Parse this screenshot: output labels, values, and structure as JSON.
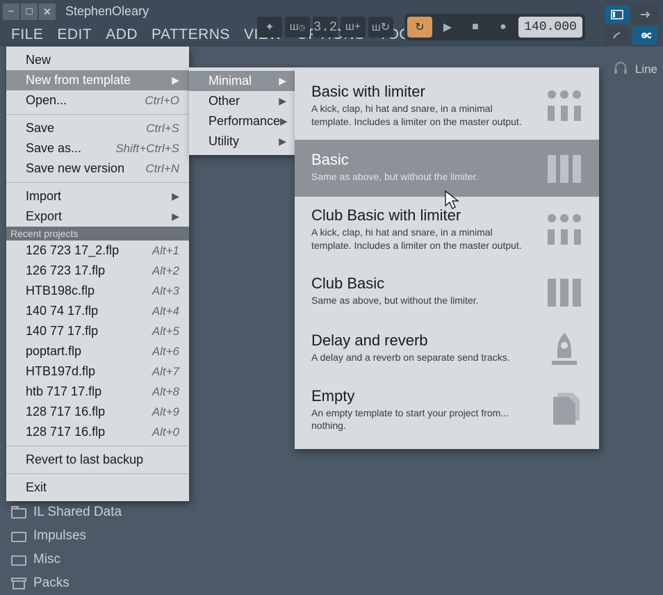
{
  "title": "StephenOleary",
  "menubar": [
    "FILE",
    "EDIT",
    "ADD",
    "PATTERNS",
    "VIEW",
    "OPTIONS",
    "TOOLS",
    "?"
  ],
  "file_menu": {
    "items1": [
      {
        "label": "New",
        "sc": "",
        "arrow": false,
        "hi": false
      },
      {
        "label": "New from template",
        "sc": "",
        "arrow": true,
        "hi": true
      },
      {
        "label": "Open...",
        "sc": "Ctrl+O",
        "arrow": false,
        "hi": false
      }
    ],
    "items2": [
      {
        "label": "Save",
        "sc": "Ctrl+S"
      },
      {
        "label": "Save as...",
        "sc": "Shift+Ctrl+S"
      },
      {
        "label": "Save new version",
        "sc": "Ctrl+N"
      }
    ],
    "items3": [
      {
        "label": "Import",
        "arrow": true
      },
      {
        "label": "Export",
        "arrow": true
      }
    ],
    "recent_header": "Recent projects",
    "recent": [
      {
        "label": "126 723 17_2.flp",
        "sc": "Alt+1"
      },
      {
        "label": "126 723 17.flp",
        "sc": "Alt+2"
      },
      {
        "label": "HTB198c.flp",
        "sc": "Alt+3"
      },
      {
        "label": "140 74 17.flp",
        "sc": "Alt+4"
      },
      {
        "label": "140 77 17.flp",
        "sc": "Alt+5"
      },
      {
        "label": "poptart.flp",
        "sc": "Alt+6"
      },
      {
        "label": "HTB197d.flp",
        "sc": "Alt+7"
      },
      {
        "label": "htb 717 17.flp",
        "sc": "Alt+8"
      },
      {
        "label": "128 717 16.flp",
        "sc": "Alt+9"
      },
      {
        "label": "128 717 16.flp",
        "sc": "Alt+0"
      }
    ],
    "items4": [
      {
        "label": "Revert to last backup"
      }
    ],
    "items5": [
      {
        "label": "Exit"
      }
    ]
  },
  "template_submenu": [
    {
      "label": "Minimal",
      "hi": true
    },
    {
      "label": "Other",
      "hi": false
    },
    {
      "label": "Performance",
      "hi": false
    },
    {
      "label": "Utility",
      "hi": false
    }
  ],
  "templates": [
    {
      "title": "Basic with limiter",
      "desc": "A kick, clap, hi hat and snare, in a minimal template. Includes a limiter on the master output.",
      "icon": "beat",
      "hi": false
    },
    {
      "title": "Basic",
      "desc": "Same as above, but without the limiter.",
      "icon": "bars",
      "hi": true
    },
    {
      "title": "Club Basic with limiter",
      "desc": "A kick, clap, hi hat and snare, in a minimal template. Includes a limiter on the master output.",
      "icon": "beat",
      "hi": false
    },
    {
      "title": "Club Basic",
      "desc": "Same as above, but without the limiter.",
      "icon": "bars",
      "hi": false
    },
    {
      "title": "Delay and reverb",
      "desc": "A delay and a reverb on separate send tracks.",
      "icon": "rocket",
      "hi": false
    },
    {
      "title": "Empty",
      "desc": "An empty template to start your project from... nothing.",
      "icon": "doc",
      "hi": false
    }
  ],
  "browser": [
    "IL Shared Data",
    "Impulses",
    "Misc",
    "Packs"
  ],
  "toolbar": {
    "pat": "3.2",
    "tempo": "140.000"
  },
  "hint": "Line"
}
